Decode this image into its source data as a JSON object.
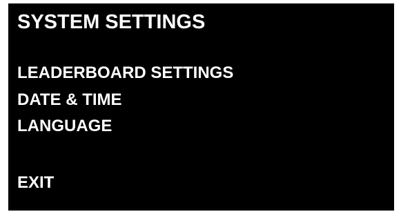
{
  "screen": {
    "title": "SYSTEM SETTINGS",
    "menu_items": [
      {
        "label": "LEADERBOARD SETTINGS"
      },
      {
        "label": "DATE & TIME"
      },
      {
        "label": "LANGUAGE"
      }
    ],
    "exit_label": "EXIT"
  },
  "colors": {
    "background": "#000000",
    "text": "#ffffff"
  }
}
